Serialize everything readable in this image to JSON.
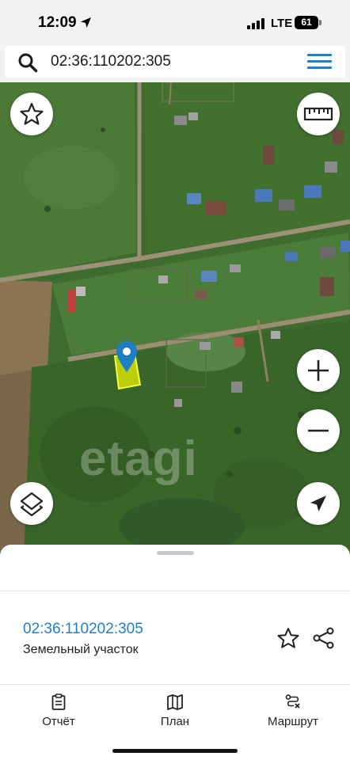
{
  "status_bar": {
    "time": "12:09",
    "network": "LTE",
    "battery": "61"
  },
  "search": {
    "value": "02:36:110202:305"
  },
  "map": {
    "watermark": "etagi"
  },
  "parcel": {
    "id": "02:36:110202:305",
    "type": "Земельный участок"
  },
  "tabs": [
    {
      "label": "Отчёт",
      "icon": "report-icon"
    },
    {
      "label": "План",
      "icon": "map-plan-icon"
    },
    {
      "label": "Маршрут",
      "icon": "route-icon"
    }
  ],
  "colors": {
    "accent": "#1e7fc4",
    "parcel_fill": "#e8f000",
    "marker": "#1e7fc4"
  }
}
